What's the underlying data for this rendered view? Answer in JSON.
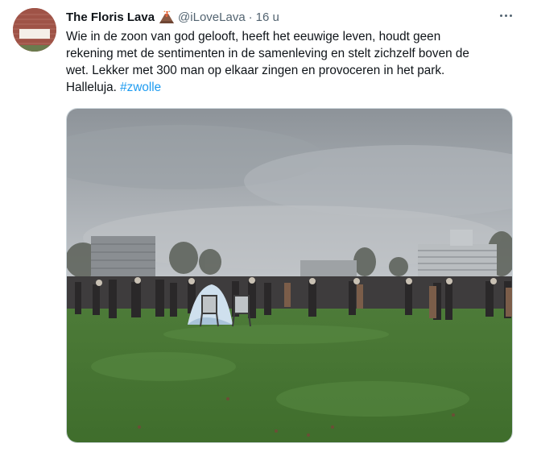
{
  "tweet": {
    "author": {
      "display_name": "The Floris Lava",
      "handle": "@iLoveLava",
      "separator": "·",
      "time": "16 u",
      "avatar_caption": "The Floris Lava",
      "emoji": "volcano-emoji"
    },
    "text_lines": [
      "Wie in de zoon van god gelooft, heeft het eeuwige leven, houdt geen",
      "rekening met de sentimenten in de samenleving en stelt zichzelf boven de",
      "wet. Lekker met 300 man op elkaar zingen en provoceren in het park.",
      "Halleluja. "
    ],
    "hashtag": "#zwolle",
    "more_icon": "more-icon",
    "media": {
      "kind": "photo",
      "subject": "crowd gathered on a grass field in a park under an overcast sky"
    }
  },
  "colors": {
    "text": "#0f1419",
    "secondary": "#536471",
    "link": "#1d9bf0",
    "border": "#cfd9de"
  }
}
